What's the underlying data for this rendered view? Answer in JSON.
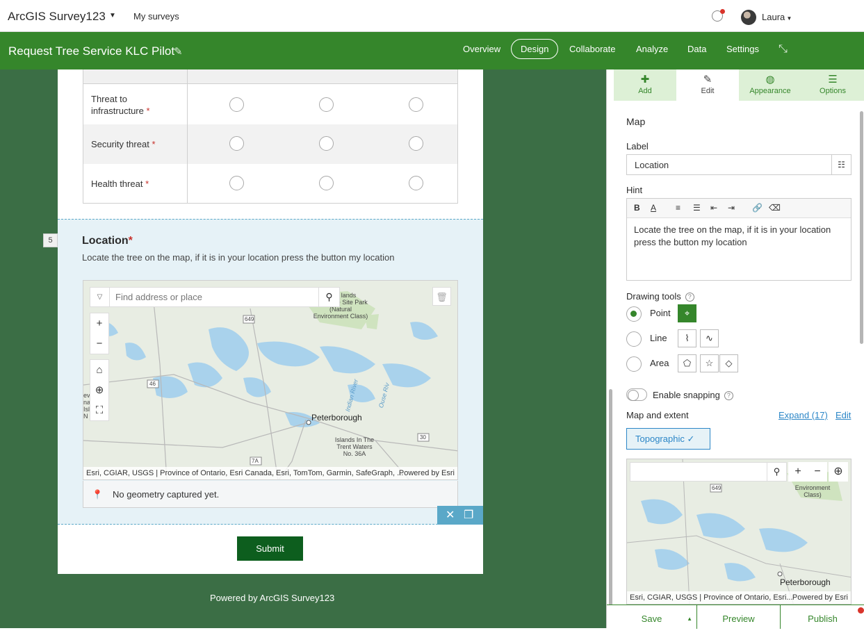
{
  "app": {
    "title": "ArcGIS Survey123",
    "my_surveys": "My surveys",
    "user": "Laura"
  },
  "survey": {
    "title": "Request Tree Service KLC Pilot"
  },
  "nav": {
    "tabs": [
      "Overview",
      "Design",
      "Collaborate",
      "Analyze",
      "Data",
      "Settings"
    ],
    "active": "Design"
  },
  "likert": {
    "rows": [
      {
        "label": "Threat to infrastructure",
        "required": true
      },
      {
        "label": "Security threat",
        "required": true
      },
      {
        "label": "Health threat",
        "required": true
      }
    ]
  },
  "question": {
    "number": "5",
    "title": "Location",
    "required_mark": "*",
    "hint": "Locate the tree on the map, if it is in your location press the button my location",
    "geometry_status": "No geometry captured yet."
  },
  "map": {
    "search_placeholder": "Find address or place",
    "attribution": "Esri, CGIAR, USGS | Province of Ontario, Esri Canada, Esri, TomTom, Garmin, SafeGraph, ...",
    "powered": "Powered by Esri",
    "labels": {
      "city": "Peterborough",
      "park": "artha lands Signature Site Park (Natural Environment Class)",
      "reserve": "Islands In The Trent Waters No. 36A",
      "hwy1": "649",
      "hwy2": "46",
      "hwy3": "30",
      "hwy4": "7A",
      "river1": "Indian River",
      "river2": "Ouse Riv",
      "left": "ev na Island N"
    }
  },
  "form": {
    "submit": "Submit",
    "powered": "Powered by ArcGIS Survey123"
  },
  "panel": {
    "tabs": [
      {
        "label": "Add",
        "icon": "plus-icon"
      },
      {
        "label": "Edit",
        "icon": "pencil-icon"
      },
      {
        "label": "Appearance",
        "icon": "palette-icon"
      },
      {
        "label": "Options",
        "icon": "sliders-icon"
      }
    ],
    "heading": "Map",
    "label_title": "Label",
    "label_value": "Location",
    "hint_title": "Hint",
    "hint_value": "Locate the tree on the map, if it is in your location press the button my location",
    "drawing_tools": "Drawing tools",
    "options": [
      "Point",
      "Line",
      "Area"
    ],
    "snapping": "Enable snapping",
    "map_extent": "Map and extent",
    "expand": "Expand (17)",
    "edit": "Edit",
    "basemap": "Topographic",
    "mini_attrib": "Esri, CGIAR, USGS | Province of Ontario, Esri...",
    "mini_powered": "Powered by Esri",
    "mini_city": "Peterborough",
    "mini_env": "Environment Class)",
    "mini_hwy": "649"
  },
  "footer": {
    "save": "Save",
    "preview": "Preview",
    "publish": "Publish"
  },
  "colors": {
    "brand_green": "#35862b",
    "submit_green": "#0d5e1e",
    "bg_green": "#3b6e45",
    "accent_blue": "#2b86c7",
    "required_red": "#c8312b"
  }
}
